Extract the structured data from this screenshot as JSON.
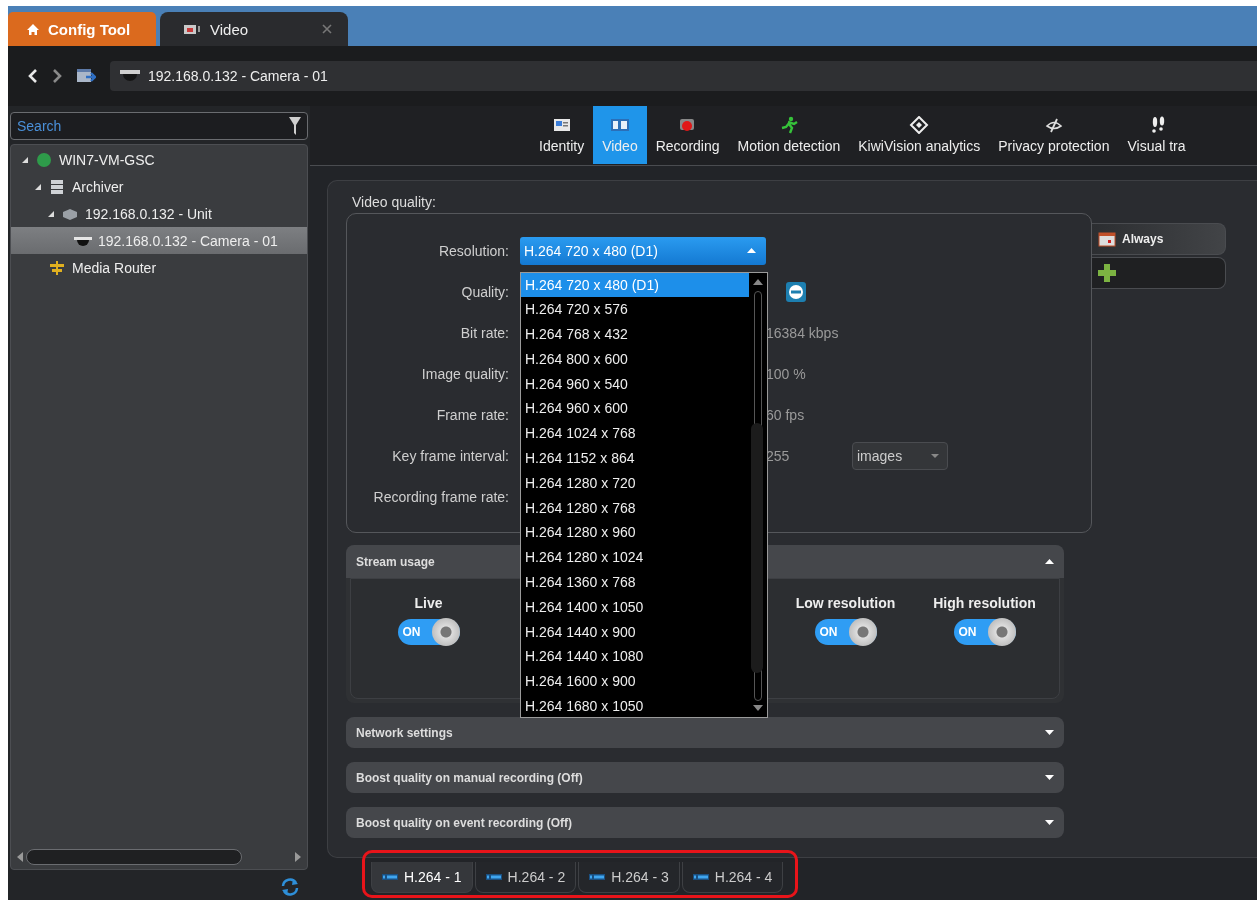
{
  "title_bar": {
    "tabs": [
      {
        "label": "Config Tool",
        "kind": "home"
      },
      {
        "label": "Video",
        "kind": "video"
      }
    ]
  },
  "address_bar": {
    "text": "192.168.0.132 - Camera - 01"
  },
  "sidebar": {
    "search": {
      "placeholder": "Search"
    },
    "tree": [
      {
        "label": "WIN7-VM-GSC",
        "kind": "server",
        "expanded": true,
        "selected": false,
        "children": [
          {
            "label": "Archiver",
            "kind": "archiver",
            "expanded": true,
            "selected": false,
            "children": [
              {
                "label": "192.168.0.132 - Unit",
                "kind": "unit",
                "expanded": true,
                "selected": false,
                "children": [
                  {
                    "label": "192.168.0.132 - Camera - 01",
                    "kind": "camera",
                    "selected": true
                  }
                ]
              }
            ]
          },
          {
            "label": "Media Router",
            "kind": "router",
            "selected": false
          }
        ]
      }
    ]
  },
  "toolbar": {
    "tabs": [
      {
        "label": "Identity",
        "kind": "identity",
        "selected": false
      },
      {
        "label": "Video",
        "kind": "video",
        "selected": true
      },
      {
        "label": "Recording",
        "kind": "recording",
        "selected": false
      },
      {
        "label": "Motion detection",
        "kind": "motion",
        "selected": false
      },
      {
        "label": "KiwiVision analytics",
        "kind": "analytics",
        "selected": false
      },
      {
        "label": "Privacy protection",
        "kind": "privacy",
        "selected": false
      },
      {
        "label": "Visual tra",
        "kind": "visual",
        "selected": false
      }
    ]
  },
  "video_quality": {
    "title": "Video quality:",
    "rows": [
      {
        "label": "Resolution:",
        "kind": "dropdown",
        "value": "H.264 720 x 480 (D1)",
        "open": true,
        "options": [
          {
            "label": "H.264 720 x 480 (D1)",
            "selected": true
          },
          {
            "label": "H.264 720 x 576",
            "selected": false
          },
          {
            "label": "H.264 768 x 432",
            "selected": false
          },
          {
            "label": "H.264 800 x 600",
            "selected": false
          },
          {
            "label": "H.264 960 x 540",
            "selected": false
          },
          {
            "label": "H.264 960 x 600",
            "selected": false
          },
          {
            "label": "H.264 1024 x 768",
            "selected": false
          },
          {
            "label": "H.264 1152 x 864",
            "selected": false
          },
          {
            "label": "H.264 1280 x 720",
            "selected": false
          },
          {
            "label": "H.264 1280 x 768",
            "selected": false
          },
          {
            "label": "H.264 1280 x 960",
            "selected": false
          },
          {
            "label": "H.264 1280 x 1024",
            "selected": false
          },
          {
            "label": "H.264 1360 x 768",
            "selected": false
          },
          {
            "label": "H.264 1400 x 1050",
            "selected": false
          },
          {
            "label": "H.264 1440 x 900",
            "selected": false
          },
          {
            "label": "H.264 1440 x 1080",
            "selected": false
          },
          {
            "label": "H.264 1600 x 900",
            "selected": false
          },
          {
            "label": "H.264 1680 x 1050",
            "selected": false
          }
        ]
      },
      {
        "label": "Quality:",
        "kind": "remove-button"
      },
      {
        "label": "Bit rate:",
        "kind": "reading",
        "value": "16384 kbps"
      },
      {
        "label": "Image quality:",
        "kind": "reading",
        "value": "100 %"
      },
      {
        "label": "Frame rate:",
        "kind": "reading",
        "value": "60 fps"
      },
      {
        "label": "Key frame interval:",
        "kind": "reading",
        "value": "255",
        "unit_select": "images"
      },
      {
        "label": "Recording frame rate:",
        "kind": "empty"
      }
    ]
  },
  "schedules": [
    {
      "label": "Always",
      "kind": "schedule"
    },
    {
      "kind": "add"
    }
  ],
  "stream_usage": {
    "title": "Stream usage",
    "expanded": true,
    "toggles": [
      {
        "label": "Live",
        "on": true,
        "state_label": "ON"
      },
      {
        "label": "Low resolution",
        "on": true,
        "state_label": "ON"
      },
      {
        "label": "High resolution",
        "on": true,
        "state_label": "ON"
      }
    ]
  },
  "sections": [
    {
      "title": "Network settings",
      "expanded": false
    },
    {
      "title": "Boost quality on manual recording (Off)",
      "expanded": false
    },
    {
      "title": "Boost quality on event recording (Off)",
      "expanded": false
    }
  ],
  "stream_tabs": [
    {
      "label": "H.264 - 1",
      "selected": true
    },
    {
      "label": "H.264 - 2",
      "selected": false
    },
    {
      "label": "H.264 - 3",
      "selected": false
    },
    {
      "label": "H.264 - 4",
      "selected": false
    }
  ]
}
